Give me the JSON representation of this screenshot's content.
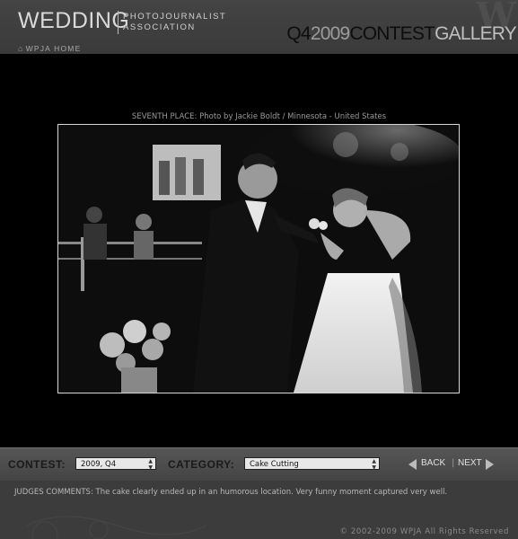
{
  "header": {
    "logo_main": "WEDDING",
    "logo_sub_line1": "PHOTOJOURNALIST",
    "logo_sub_line2": "ASSOCIATION",
    "home_link": "WPJA HOME",
    "home_icon": "home-icon",
    "title_quarter": "Q4",
    "title_year": "2009",
    "title_contest": "CONTEST",
    "title_gallery": "GALLERY"
  },
  "photo": {
    "caption": "SEVENTH PLACE: Photo by Jackie Boldt / Minnesota - United States"
  },
  "controls": {
    "contest_label": "CONTEST:",
    "contest_value": "2009, Q4",
    "category_label": "CATEGORY:",
    "category_value": "Cake Cutting",
    "back_label": "BACK",
    "separator": "|",
    "next_label": "NEXT",
    "back_icon": "triangle-left-icon",
    "next_icon": "triangle-right-icon"
  },
  "comments": {
    "text": "JUDGES COMMENTS: The cake clearly ended up in an humorous location. Very funny moment captured very well."
  },
  "footer": {
    "copyright": "© 2002-2009 WPJA  All Rights Reserved"
  },
  "colors": {
    "background": "#000000",
    "header_bg": "#404040",
    "control_bar": "#4d4d4d",
    "select_bg": "#e8e8e8",
    "accent_gray": "#9c9c9c"
  }
}
